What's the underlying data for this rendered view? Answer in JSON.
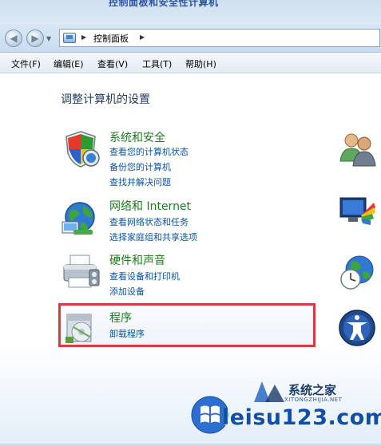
{
  "window": {
    "cutoff_title": "控制面板和安全性计算机"
  },
  "nav": {
    "breadcrumb": "控制面板"
  },
  "menu": {
    "items": [
      "文件(F)",
      "编辑(E)",
      "查看(V)",
      "工具(T)",
      "帮助(H)"
    ]
  },
  "main": {
    "title": "调整计算机的设置",
    "categories": [
      {
        "title": "系统和安全",
        "links": [
          "查看您的计算机状态",
          "备份您的计算机",
          "查找并解决问题"
        ]
      },
      {
        "title": "网络和 Internet",
        "links": [
          "查看网络状态和任务",
          "选择家庭组和共享选项"
        ]
      },
      {
        "title": "硬件和声音",
        "links": [
          "查看设备和打印机",
          "添加设备"
        ]
      },
      {
        "title": "程序",
        "links": [
          "卸载程序"
        ]
      }
    ]
  },
  "watermark": {
    "site": "leisu123.com",
    "brand": "系统之家",
    "brand_sub": "XITONGZHIJIA.NET"
  },
  "colors": {
    "category_title": "#1e7b1e",
    "link": "#0a53a8",
    "highlight_border": "#d73a41",
    "watermark": "#0f4fa7"
  }
}
